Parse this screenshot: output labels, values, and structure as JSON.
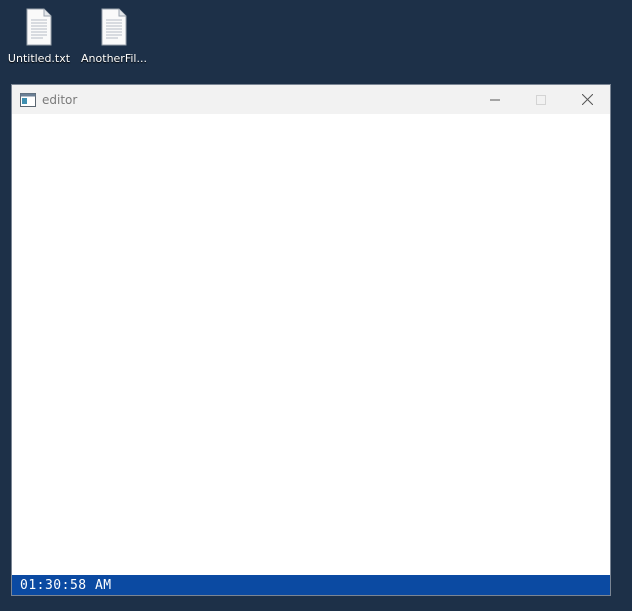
{
  "desktop": {
    "icons": [
      {
        "label": "Untitled.txt",
        "icon": "text-file-icon"
      },
      {
        "label": "AnotherFil...",
        "icon": "text-file-icon"
      }
    ]
  },
  "window": {
    "title": "editor",
    "app_icon": "editor-app-icon",
    "controls": {
      "minimize": "minimize-icon",
      "maximize": "maximize-icon",
      "close": "close-icon"
    }
  },
  "statusbar": {
    "time": "01:30:58 AM"
  },
  "colors": {
    "desktop_bg": "#1d3048",
    "statusbar_bg": "#0b4aa2",
    "titlebar_bg": "#f2f2f2"
  }
}
